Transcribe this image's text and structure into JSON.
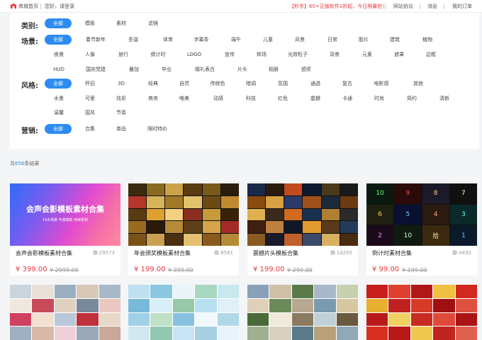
{
  "topbar": {
    "home": "商城首页",
    "greeting": "您好，请登录",
    "promo": "【秒杀】60+正版软件1折起，今日限量抢！",
    "links": [
      "网站协议",
      "消息",
      "我的订单"
    ],
    "brand_color": "#e4393c"
  },
  "filters": {
    "category": {
      "label": "类别:",
      "items": [
        "全部",
        "模板",
        "素材",
        "滤镜"
      ]
    },
    "scene": {
      "label": "场景:",
      "items": [
        "全部",
        "春节新年",
        "圣诞",
        "体育",
        "字幕条",
        "端午",
        "儿童",
        "风景",
        "日常",
        "胶片",
        "建筑",
        "植物",
        "夜景",
        "人像",
        "旅行",
        "倒计时",
        "LOGO",
        "宣传",
        "转场",
        "光效粒子",
        "背景",
        "元素",
        "遮罩",
        "边框",
        "HUD",
        "国庆党建",
        "叠加",
        "毕业",
        "婚礼表白",
        "片头",
        "相册",
        "颁奖"
      ]
    },
    "style": {
      "label": "风格:",
      "items": [
        "全部",
        "怀旧",
        "3D",
        "经典",
        "自然",
        "传统色",
        "暗调",
        "氛围",
        "通透",
        "复古",
        "电影感",
        "其他",
        "水墨",
        "可爱",
        "炫彩",
        "商务",
        "唯美",
        "动感",
        "科技",
        "红色",
        "震撼",
        "卡通",
        "时尚",
        "简约",
        "清新",
        "温馨",
        "国风",
        "节奏"
      ]
    },
    "marketing": {
      "label": "营销:",
      "items": [
        "全部",
        "合集",
        "单品",
        "限时特价"
      ]
    },
    "accent": "#2d8cf0"
  },
  "results": {
    "prefix": "共",
    "count": "656",
    "suffix": "条结果"
  },
  "cards": [
    {
      "title": "会声会影模板素材合集",
      "likes": "29573",
      "price": "¥ 399.00",
      "old": "¥ 2999.00",
      "thumb_text": "会声会影模板素材合集",
      "thumb_sub": "14大场景   丰富模板   持续更新"
    },
    {
      "title": "年会颁奖模板素材合集",
      "likes": "8561",
      "price": "¥ 199.00",
      "old": "¥ 399.00"
    },
    {
      "title": "震撼片头模板合集",
      "likes": "14205",
      "price": "¥ 199.00",
      "old": "¥ 299.00"
    },
    {
      "title": "倒计时素材合集",
      "likes": "4492",
      "price": "¥ 99.00",
      "old": "¥ 199.00",
      "countdown": [
        "10",
        "9",
        "8",
        "7",
        "6",
        "5",
        "4",
        "3",
        "2",
        "10",
        "拾",
        "1"
      ]
    }
  ]
}
